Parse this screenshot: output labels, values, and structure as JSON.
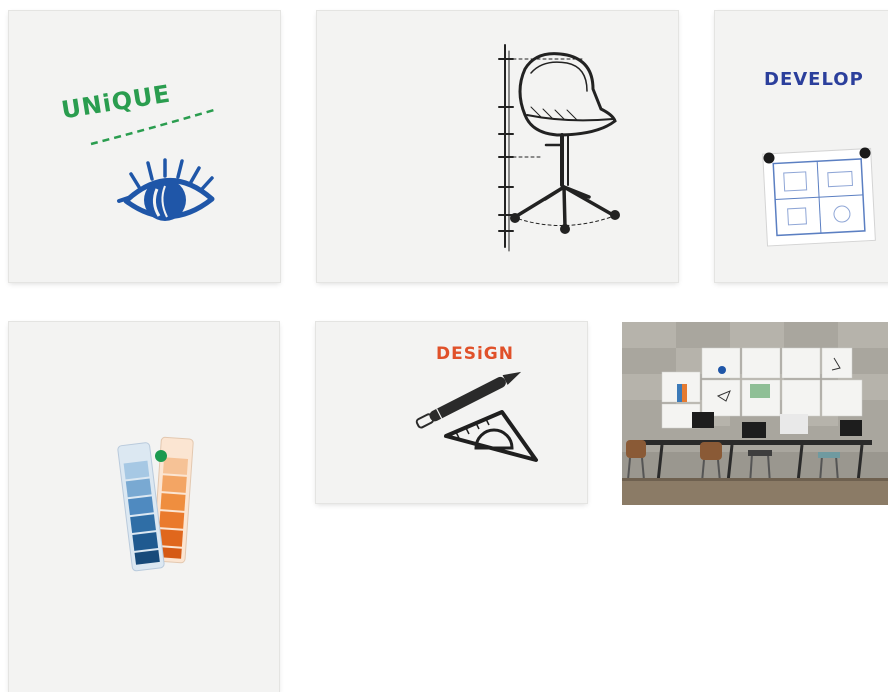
{
  "tiles": {
    "unique": {
      "word": "UNiQUE",
      "color": "#2a9d4f",
      "icon": "eye-icon",
      "icon_color": "#1f56a8"
    },
    "chair": {
      "icon": "chair-sketch-icon"
    },
    "develop": {
      "word": "DEVELOP",
      "color": "#2b3f9c",
      "icon": "blueprint-icon"
    },
    "colors": {
      "icon": "color-swatch-icon",
      "blue": "#2f6ea6",
      "orange": "#ea7a2c"
    },
    "design": {
      "word": "DESiGN",
      "color": "#e0512a",
      "icon": "pen-and-protractor-icon"
    },
    "office": {
      "icon": "office-photo"
    }
  }
}
